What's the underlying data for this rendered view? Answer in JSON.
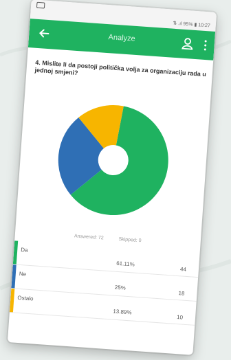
{
  "status_bar": {
    "text": "⇅ .ıl 95% ▮ 10:27"
  },
  "app_bar": {
    "title": "Analyze"
  },
  "question": {
    "text": "4. Mislite li da postoji politička volja za organizaciju rada u jednoj smjeni?"
  },
  "chart_data": {
    "type": "pie",
    "categories": [
      "Da",
      "Ne",
      "Ostalo"
    ],
    "values": [
      44,
      18,
      10
    ],
    "percentages": [
      61.11,
      25,
      13.89
    ],
    "colors": [
      "#1fb260",
      "#2f6fb5",
      "#f7b500"
    ],
    "donut_hole": true
  },
  "meta": {
    "answered": "Answered: 72",
    "skipped": "Skipped: 0"
  },
  "rows": [
    {
      "label": "Da",
      "pct": "61.11%",
      "count": "44",
      "color": "#1fb260"
    },
    {
      "label": "Ne",
      "pct": "25%",
      "count": "18",
      "color": "#2f6fb5"
    },
    {
      "label": "Ostalo",
      "pct": "13.89%",
      "count": "10",
      "color": "#f7b500"
    }
  ]
}
